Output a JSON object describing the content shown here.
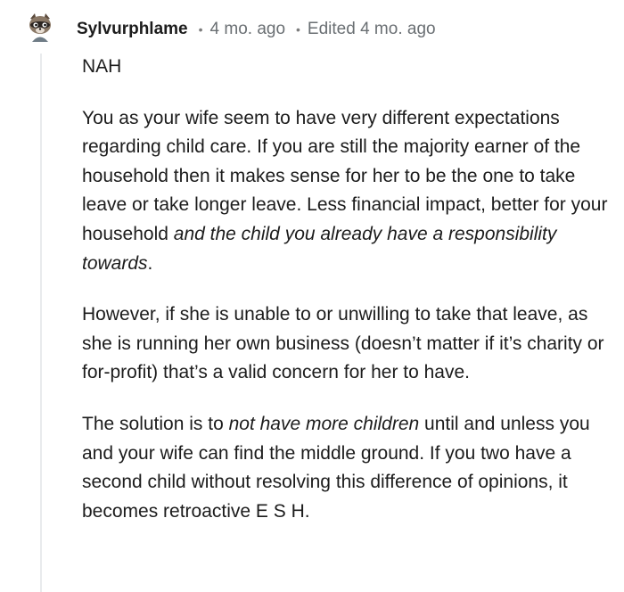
{
  "comment": {
    "author": "Sylvurphlame",
    "time": "4 mo. ago",
    "edited": "Edited 4 mo. ago",
    "verdict": "NAH",
    "para1": {
      "text_a": "You as your wife seem to have very different expectations regarding child care. If you are still the majority earner of the household then it makes sense for her to be the one to take leave or take longer leave. Less financial impact, better for your household ",
      "italic": "and the child you already have a responsibility towards",
      "text_b": "."
    },
    "para2": {
      "text": "However, if she is unable to or unwilling to take that leave, as she is running her own business (doesn’t matter if it’s charity or for-profit) that’s a valid concern for her to have."
    },
    "para3": {
      "text_a": "The solution is to ",
      "italic": "not have more children",
      "text_b": " until and unless you and your wife can find the middle ground. If you two have a second child without resolving this difference of opinions, it becomes retroactive E S H."
    }
  },
  "icons": {
    "avatar": "raccoon-snoo-avatar-icon",
    "separator": "dot-separator"
  },
  "colors": {
    "text": "#1c1c1c",
    "meta": "#6a6f73",
    "thread_line": "#e9ebed"
  }
}
